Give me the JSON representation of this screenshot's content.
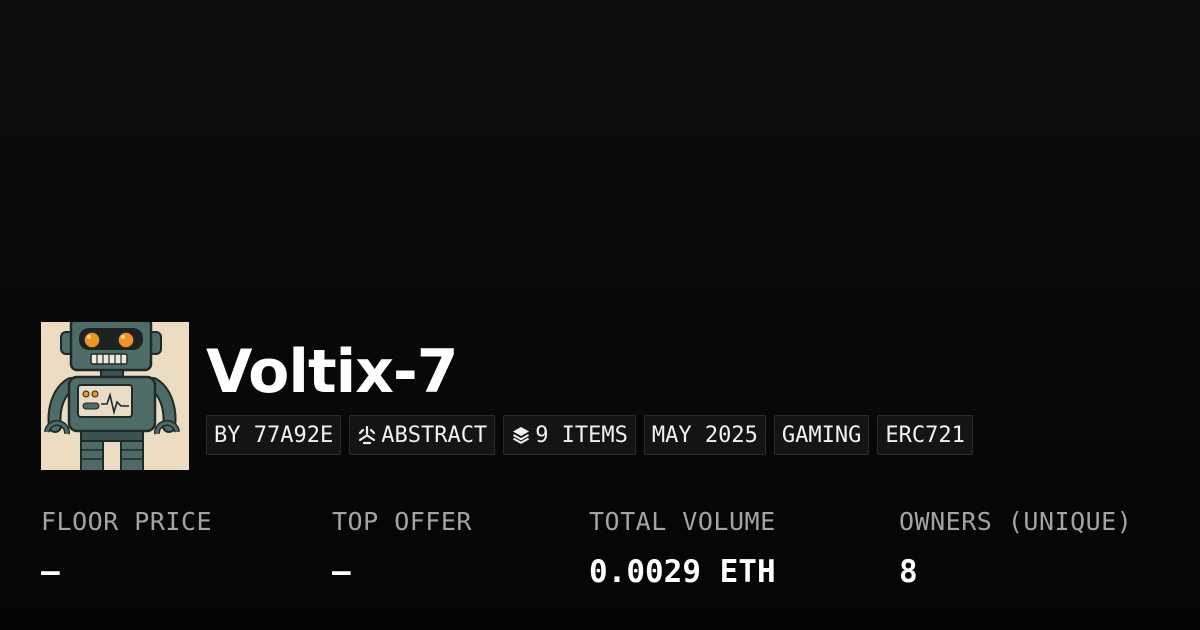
{
  "collection": {
    "title": "Voltix-7"
  },
  "tags": {
    "creator": "BY 77A92E",
    "chain": "ABSTRACT",
    "items": "9 ITEMS",
    "date": "MAY 2025",
    "category": "GAMING",
    "standard": "ERC721"
  },
  "stats": {
    "floor_price": {
      "label": "FLOOR PRICE",
      "value": "–"
    },
    "top_offer": {
      "label": "TOP OFFER",
      "value": "–"
    },
    "total_volume": {
      "label": "TOTAL VOLUME",
      "value": "0.0029 ETH"
    },
    "owners": {
      "label": "OWNERS (UNIQUE)",
      "value": "8"
    }
  },
  "icons": {
    "chain": "abstract-logo-icon",
    "items": "layers-icon"
  },
  "colors": {
    "background": "#0a0a0a",
    "text_primary": "#ffffff",
    "text_secondary": "#a4a4a4",
    "tag_background": "#141414",
    "avatar_background": "#ecdcc2",
    "robot_teal": "#4e6b68",
    "robot_eye": "#f39321"
  }
}
